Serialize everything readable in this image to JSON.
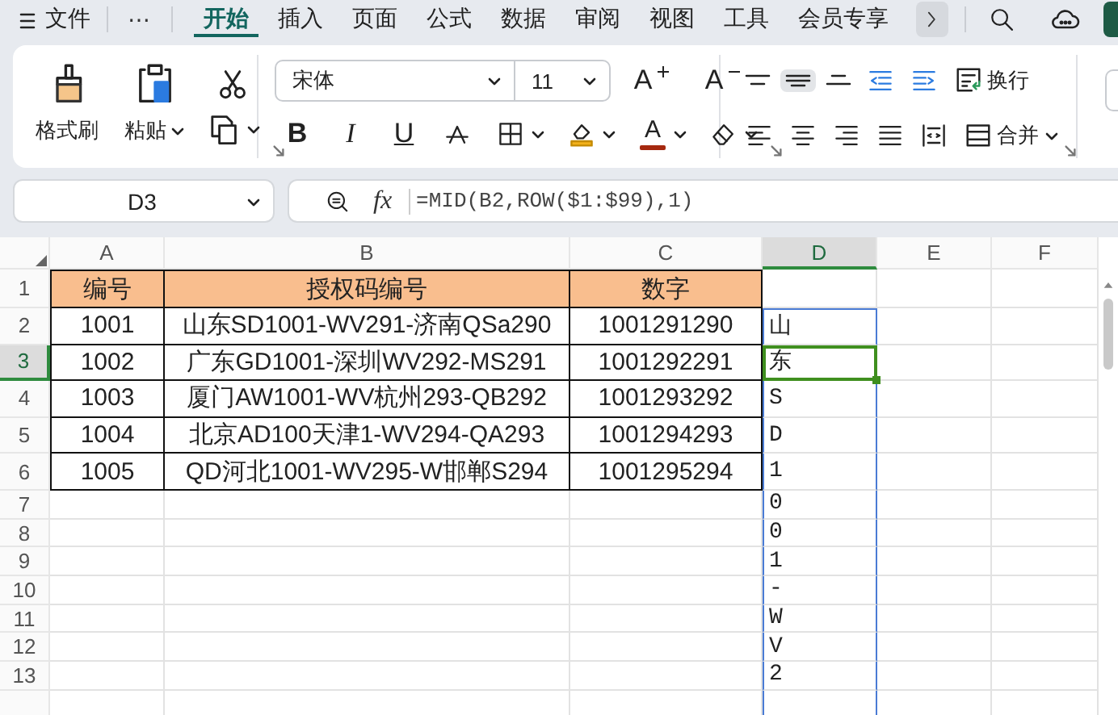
{
  "menu": {
    "file": "文件",
    "more": "⋯",
    "tabs": [
      {
        "label": "开始",
        "selected": true
      },
      {
        "label": "插入",
        "selected": false
      },
      {
        "label": "页面",
        "selected": false
      },
      {
        "label": "公式",
        "selected": false
      },
      {
        "label": "数据",
        "selected": false
      },
      {
        "label": "审阅",
        "selected": false
      },
      {
        "label": "视图",
        "selected": false
      },
      {
        "label": "工具",
        "selected": false
      },
      {
        "label": "会员专享",
        "selected": false
      }
    ]
  },
  "ribbon": {
    "clipboard": [
      {
        "kind": "format-painter",
        "label": "格式刷",
        "dropdown": false
      },
      {
        "kind": "paste",
        "label": "粘贴",
        "dropdown": true
      },
      {
        "kind": "cut",
        "dropdown": false
      },
      {
        "kind": "copy",
        "dropdown": true
      }
    ],
    "font": {
      "name": "宋体",
      "size": "11",
      "tools": [
        {
          "kind": "grow",
          "glyph": "A",
          "dropdown": false
        },
        {
          "kind": "shrink",
          "glyph": "A",
          "dropdown": false
        },
        {
          "kind": "bold",
          "glyph": "B",
          "dropdown": false
        },
        {
          "kind": "italic",
          "glyph": "I",
          "dropdown": false
        },
        {
          "kind": "underline",
          "glyph": "U",
          "dropdown": false
        },
        {
          "kind": "strikethrough",
          "dropdown": false
        },
        {
          "kind": "borders",
          "dropdown": true
        },
        {
          "kind": "fill-color",
          "dropdown": true
        },
        {
          "kind": "font-color",
          "glyph": "A",
          "dropdown": true
        },
        {
          "kind": "clear",
          "dropdown": true
        }
      ]
    },
    "alignment": {
      "tools": [
        {
          "kind": "top",
          "selected": false
        },
        {
          "kind": "middle",
          "selected": true
        },
        {
          "kind": "bottom",
          "selected": false
        },
        {
          "kind": "indent-less",
          "selected": false
        },
        {
          "kind": "indent-more",
          "selected": false
        },
        {
          "kind": "left",
          "selected": false
        },
        {
          "kind": "center",
          "selected": false
        },
        {
          "kind": "right",
          "selected": false
        },
        {
          "kind": "justify",
          "selected": false
        },
        {
          "kind": "distributed",
          "selected": false
        }
      ],
      "wrap": "换行",
      "merge": "合并"
    }
  },
  "formula_bar": {
    "name_box": "D3",
    "fx": "fx",
    "formula": "=MID(B2,ROW($1:$99),1)"
  },
  "sheet": {
    "columns": [
      {
        "label": "A",
        "selected": false
      },
      {
        "label": "B",
        "selected": false
      },
      {
        "label": "C",
        "selected": false
      },
      {
        "label": "D",
        "selected": true
      },
      {
        "label": "E",
        "selected": false
      },
      {
        "label": "F",
        "selected": false
      }
    ],
    "rows": [
      {
        "label": "1",
        "selected": false,
        "cells": {
          "A": "编号",
          "B": "授权码编号",
          "C": "数字"
        }
      },
      {
        "label": "2",
        "selected": false,
        "cells": {
          "A": "1001",
          "B": "山东SD1001-WV291-济南QSa290",
          "C": "1001291290",
          "D": "山"
        }
      },
      {
        "label": "3",
        "selected": true,
        "cells": {
          "A": "1002",
          "B": "广东GD1001-深圳WV292-MS291",
          "C": "1001292291",
          "D": "东"
        }
      },
      {
        "label": "4",
        "selected": false,
        "cells": {
          "A": "1003",
          "B": "厦门AW1001-WV杭州293-QB292",
          "C": "1001293292",
          "D": "S"
        }
      },
      {
        "label": "5",
        "selected": false,
        "cells": {
          "A": "1004",
          "B": "北京AD100天津1-WV294-QA293",
          "C": "1001294293",
          "D": "D"
        }
      },
      {
        "label": "6",
        "selected": false,
        "cells": {
          "A": "1005",
          "B": "QD河北1001-WV295-W邯郸S294",
          "C": "1001295294",
          "D": "1"
        }
      },
      {
        "label": "7",
        "selected": false,
        "cells": {
          "D": "0"
        }
      },
      {
        "label": "8",
        "selected": false,
        "cells": {
          "D": "0"
        }
      },
      {
        "label": "9",
        "selected": false,
        "cells": {
          "D": "1"
        }
      },
      {
        "label": "10",
        "selected": false,
        "cells": {
          "D": "-"
        }
      },
      {
        "label": "11",
        "selected": false,
        "cells": {
          "D": "W"
        }
      },
      {
        "label": "12",
        "selected": false,
        "cells": {
          "D": "V"
        }
      },
      {
        "label": "13",
        "selected": false,
        "cells": {
          "D": "2"
        }
      }
    ]
  }
}
